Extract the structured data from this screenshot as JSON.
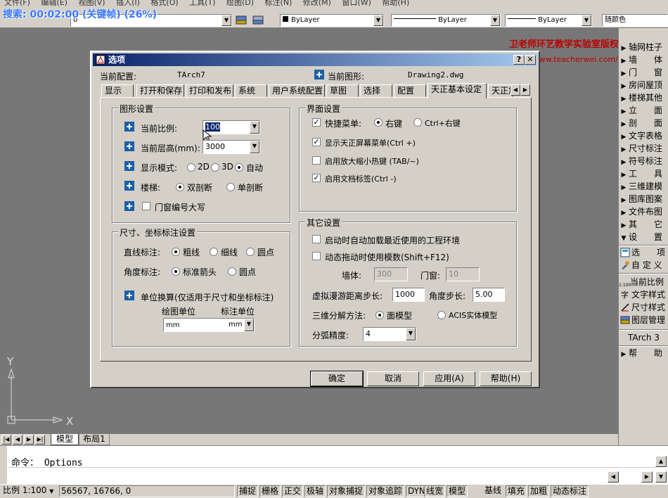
{
  "menubar": [
    "文件(F)",
    "编辑(E)",
    "视图(V)",
    "插入(I)",
    "格式(O)",
    "工具(T)",
    "绘图(D)",
    "标注(N)",
    "修改(M)",
    "窗口(W)",
    "帮助(H)"
  ],
  "recording": "捜索: 00:02:00 (关键帧) (26%)",
  "toolbar": {
    "layer_value": "0",
    "color_value": "ByLayer",
    "linetype_value": "ByLayer",
    "lineweight_value": "ByLayer",
    "plotstyle_value": "随颜色"
  },
  "watermark": {
    "line1": "卫老师环艺教学实验室版权所有",
    "line2": "http://www.teacherwei.com/"
  },
  "palette": {
    "items": [
      "轴网柱子",
      "墙　　体",
      "门　　窗",
      "房间屋顶",
      "楼梯其他",
      "立　　面",
      "剖　　面",
      "文字表格",
      "尺寸标注",
      "符号标注",
      "工　　具",
      "三维建模",
      "图库图案",
      "文件布图",
      "其　　它",
      "设　　置"
    ],
    "sub_items": [
      "选　　项",
      "自 定 义"
    ],
    "lower_items": [
      "当前比例",
      "文字样式",
      "尺寸样式",
      "图层管理"
    ],
    "version": "TArch 3",
    "help": "帮　　助",
    "scale_badge": "1:100"
  },
  "axes": {
    "x": "X",
    "y": "Y"
  },
  "layout_tabs": [
    "模型",
    "布局1"
  ],
  "command": {
    "prompt": "命令：",
    "value": "Options"
  },
  "status": {
    "scale": "比例 1:100",
    "coords": "56567, 16766, 0",
    "buttons": [
      "捕捉",
      "栅格",
      "正交",
      "极轴",
      "对象捕捉",
      "对象追踪",
      "DYN",
      "线宽",
      "模型",
      "基线",
      "填充",
      "加粗",
      "动态标注"
    ]
  },
  "dialog": {
    "title": "选项",
    "current_profile_label": "当前配置:",
    "current_profile": "TArch7",
    "current_drawing_label": "当前图形:",
    "current_drawing": "Drawing2.dwg",
    "tabs": [
      "显示",
      "打开和保存",
      "打印和发布",
      "系统",
      "用户系统配置",
      "草图",
      "选择",
      "配置",
      "天正基本设定",
      "天正加"
    ],
    "graphics": {
      "title": "图形设置",
      "scale_label": "当前比例:",
      "scale_value": "100",
      "height_label": "当前层高(mm):",
      "height_value": "3000",
      "mode_label": "显示模式:",
      "mode_options": [
        "2D",
        "3D",
        "自动"
      ],
      "stair_label": "楼梯:",
      "stair_options": [
        "双剖断",
        "单剖断"
      ],
      "door_caps": "门窗编号大写"
    },
    "ui": {
      "title": "界面设置",
      "quick_menu": "快捷菜单:",
      "quick_opts": [
        "右键",
        "Ctrl+右键"
      ],
      "show_screen_menu": "显示天正屏幕菜单(Ctrl +)",
      "zoom_hotkey": "启用放大缩小热键 (TAB/~)",
      "doc_tabs": "启用文档标签(Ctrl -)"
    },
    "dim": {
      "title": "尺寸、坐标标注设置",
      "line_label": "直线标注:",
      "line_opts": [
        "粗线",
        "细线",
        "圆点"
      ],
      "angle_label": "角度标注:",
      "angle_opts": [
        "标准箭头",
        "圆点"
      ],
      "unit_conv": "单位换算(仅适用于尺寸和坐标标注)",
      "draw_unit": "绘图单位",
      "dim_unit": "标注单位",
      "draw_unit_val": "mm",
      "dim_unit_val": "mm"
    },
    "other": {
      "title": "其它设置",
      "autoload": "启动时自动加载最近使用的工程环境",
      "dynamic_drag": "动态拖动时使用模数(Shift+F12)",
      "wall_label": "墙体:",
      "wall_val": "300",
      "door_label": "门窗:",
      "door_val": "10",
      "roam_label": "虚拟漫游距离步长:",
      "roam_val": "1000",
      "angle_label": "角度步长:",
      "angle_val": "5.00",
      "explode_label": "三维分解方法:",
      "explode_opts": [
        "面模型",
        "ACIS实体模型"
      ],
      "arc_label": "分弧精度:",
      "arc_val": "4"
    },
    "buttons": {
      "ok": "确定",
      "cancel": "取消",
      "apply": "应用(A)",
      "help": "帮助(H)"
    }
  }
}
